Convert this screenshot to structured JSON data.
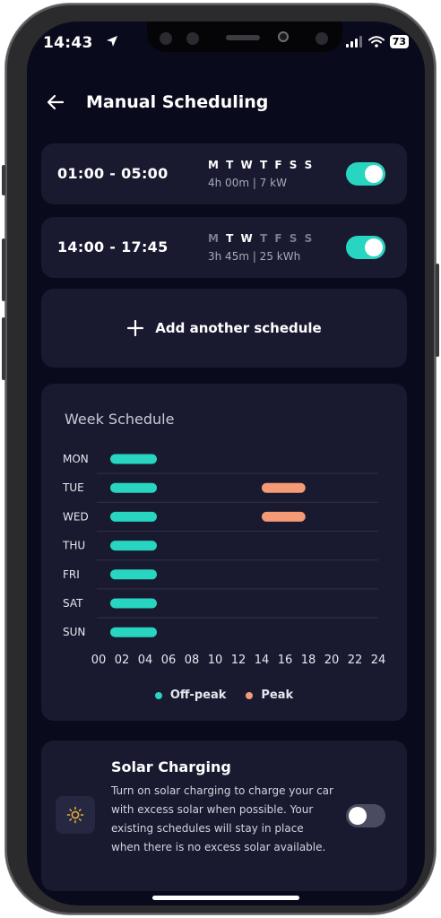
{
  "status_bar": {
    "time": "14:43",
    "battery": "73"
  },
  "header": {
    "title": "Manual Scheduling"
  },
  "schedules": [
    {
      "time": "01:00 - 05:00",
      "days": [
        "M",
        "T",
        "W",
        "T",
        "F",
        "S",
        "S"
      ],
      "active_days": [
        true,
        true,
        true,
        true,
        true,
        true,
        true
      ],
      "meta": "4h 00m | 7 kW",
      "enabled": true
    },
    {
      "time": "14:00 - 17:45",
      "days": [
        "M",
        "T",
        "W",
        "T",
        "F",
        "S",
        "S"
      ],
      "active_days": [
        false,
        true,
        true,
        false,
        false,
        false,
        false
      ],
      "meta": "3h 45m | 25 kWh",
      "enabled": true
    }
  ],
  "add_schedule": {
    "label": "Add another schedule"
  },
  "week_schedule": {
    "title": "Week Schedule",
    "legend": {
      "offpeak": "Off-peak",
      "peak": "Peak"
    }
  },
  "chart_data": {
    "type": "gantt",
    "title": "Week Schedule",
    "categories": [
      "MON",
      "TUE",
      "WED",
      "THU",
      "FRI",
      "SAT",
      "SUN"
    ],
    "x_ticks": [
      "00",
      "02",
      "04",
      "06",
      "08",
      "10",
      "12",
      "14",
      "16",
      "18",
      "20",
      "22",
      "24"
    ],
    "xlim": [
      0,
      24
    ],
    "series": [
      {
        "name": "Off-peak",
        "color": "#27d5c0",
        "intervals": [
          {
            "day": "MON",
            "start": 1,
            "end": 5
          },
          {
            "day": "TUE",
            "start": 1,
            "end": 5
          },
          {
            "day": "WED",
            "start": 1,
            "end": 5
          },
          {
            "day": "THU",
            "start": 1,
            "end": 5
          },
          {
            "day": "FRI",
            "start": 1,
            "end": 5
          },
          {
            "day": "SAT",
            "start": 1,
            "end": 5
          },
          {
            "day": "SUN",
            "start": 1,
            "end": 5
          }
        ]
      },
      {
        "name": "Peak",
        "color": "#f49b76",
        "intervals": [
          {
            "day": "TUE",
            "start": 14,
            "end": 17.75
          },
          {
            "day": "WED",
            "start": 14,
            "end": 17.75
          }
        ]
      }
    ],
    "legend_position": "bottom-center",
    "grid": true
  },
  "solar": {
    "title": "Solar Charging",
    "description": "Turn on solar charging to charge your car with excess solar when possible. Your existing schedules will stay in place when there is no excess solar available.",
    "enabled": false
  },
  "colors": {
    "background": "#0a0a1d",
    "card": "#191a30",
    "accent": "#27d5c0",
    "peak": "#f49b76"
  }
}
